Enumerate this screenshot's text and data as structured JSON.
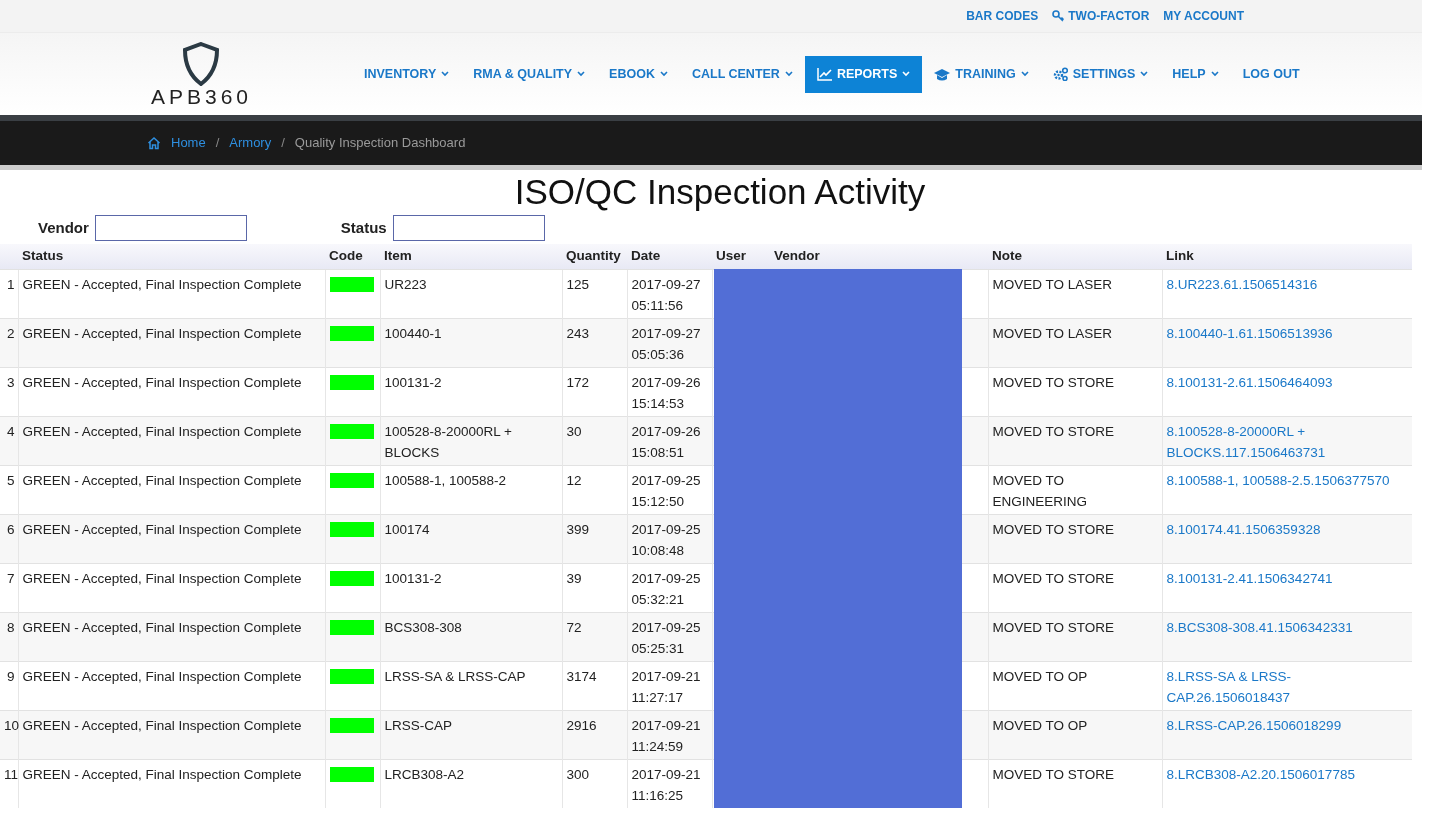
{
  "top_links": [
    {
      "label": "BAR CODES"
    },
    {
      "label": "TWO-FACTOR"
    },
    {
      "label": "MY ACCOUNT"
    }
  ],
  "logo": {
    "text": "APB360"
  },
  "nav": [
    {
      "label": "INVENTORY",
      "dropdown": true,
      "selected": false
    },
    {
      "label": "RMA & QUALITY",
      "dropdown": true,
      "selected": false
    },
    {
      "label": "EBOOK",
      "dropdown": true,
      "selected": false
    },
    {
      "label": "CALL CENTER",
      "dropdown": true,
      "selected": false
    },
    {
      "label": "REPORTS",
      "dropdown": true,
      "selected": true
    },
    {
      "label": "TRAINING",
      "dropdown": true,
      "selected": false
    },
    {
      "label": "SETTINGS",
      "dropdown": true,
      "selected": false
    },
    {
      "label": "HELP",
      "dropdown": true,
      "selected": false
    },
    {
      "label": "LOG OUT",
      "dropdown": false,
      "selected": false
    }
  ],
  "breadcrumb": [
    {
      "label": "Home",
      "kind": "link"
    },
    {
      "label": "/",
      "kind": "separator"
    },
    {
      "label": "Armory",
      "kind": "link"
    },
    {
      "label": "/",
      "kind": "separator"
    },
    {
      "label": "Quality Inspection Dashboard",
      "kind": "current"
    }
  ],
  "title": "ISO/QC Inspection Activity",
  "filters": [
    {
      "label": "Vendor"
    },
    {
      "label": "Status"
    }
  ],
  "table": {
    "columns": [
      "Status",
      "Code",
      "Item",
      "Quantity",
      "Date",
      "User",
      "Vendor",
      "Note",
      "Link"
    ],
    "rows": [
      {
        "num": "1",
        "status": "GREEN - Accepted, Final Inspection Complete",
        "color": "#00ff00",
        "item": "UR223",
        "quantity": "125",
        "date": "2017-09-27 05:11:56",
        "note": "MOVED TO LASER",
        "link": "8.UR223.61.1506514316"
      },
      {
        "num": "2",
        "status": "GREEN - Accepted, Final Inspection Complete",
        "color": "#00ff00",
        "item": "100440-1",
        "quantity": "243",
        "date": "2017-09-27 05:05:36",
        "note": "MOVED TO LASER",
        "link": "8.100440-1.61.1506513936"
      },
      {
        "num": "3",
        "status": "GREEN - Accepted, Final Inspection Complete",
        "color": "#00ff00",
        "item": "100131-2",
        "quantity": "172",
        "date": "2017-09-26 15:14:53",
        "note": "MOVED TO STORE",
        "link": "8.100131-2.61.1506464093"
      },
      {
        "num": "4",
        "status": "GREEN - Accepted, Final Inspection Complete",
        "color": "#00ff00",
        "item": "100528-8-20000RL + BLOCKS",
        "quantity": "30",
        "date": "2017-09-26 15:08:51",
        "note": "MOVED TO STORE",
        "link": "8.100528-8-20000RL + BLOCKS.117.1506463731"
      },
      {
        "num": "5",
        "status": "GREEN - Accepted, Final Inspection Complete",
        "color": "#00ff00",
        "item": "100588-1, 100588-2",
        "quantity": "12",
        "date": "2017-09-25 15:12:50",
        "note": "MOVED TO ENGINEERING",
        "link": "8.100588-1, 100588-2.5.1506377570"
      },
      {
        "num": "6",
        "status": "GREEN - Accepted, Final Inspection Complete",
        "color": "#00ff00",
        "item": "100174",
        "quantity": "399",
        "date": "2017-09-25 10:08:48",
        "note": "MOVED TO STORE",
        "link": "8.100174.41.1506359328"
      },
      {
        "num": "7",
        "status": "GREEN - Accepted, Final Inspection Complete",
        "color": "#00ff00",
        "item": "100131-2",
        "quantity": "39",
        "date": "2017-09-25 05:32:21",
        "note": "MOVED TO STORE",
        "link": "8.100131-2.41.1506342741"
      },
      {
        "num": "8",
        "status": "GREEN - Accepted, Final Inspection Complete",
        "color": "#00ff00",
        "item": "BCS308-308",
        "quantity": "72",
        "date": "2017-09-25 05:25:31",
        "note": "MOVED TO STORE",
        "link": "8.BCS308-308.41.1506342331"
      },
      {
        "num": "9",
        "status": "GREEN - Accepted, Final Inspection Complete",
        "color": "#00ff00",
        "item": "LRSS-SA & LRSS-CAP",
        "quantity": "3174",
        "date": "2017-09-21 11:27:17",
        "note": "MOVED TO OP",
        "link": "8.LRSS-SA & LRSS-CAP.26.1506018437"
      },
      {
        "num": "10",
        "status": "GREEN - Accepted, Final Inspection Complete",
        "color": "#00ff00",
        "item": "LRSS-CAP",
        "quantity": "2916",
        "date": "2017-09-21 11:24:59",
        "note": "MOVED TO OP",
        "link": "8.LRSS-CAP.26.1506018299"
      },
      {
        "num": "11",
        "status": "GREEN - Accepted, Final Inspection Complete",
        "color": "#00ff00",
        "item": "LRCB308-A2",
        "quantity": "300",
        "date": "2017-09-21 11:16:25",
        "note": "MOVED TO STORE",
        "link": "8.LRCB308-A2.20.1506017785"
      }
    ]
  }
}
